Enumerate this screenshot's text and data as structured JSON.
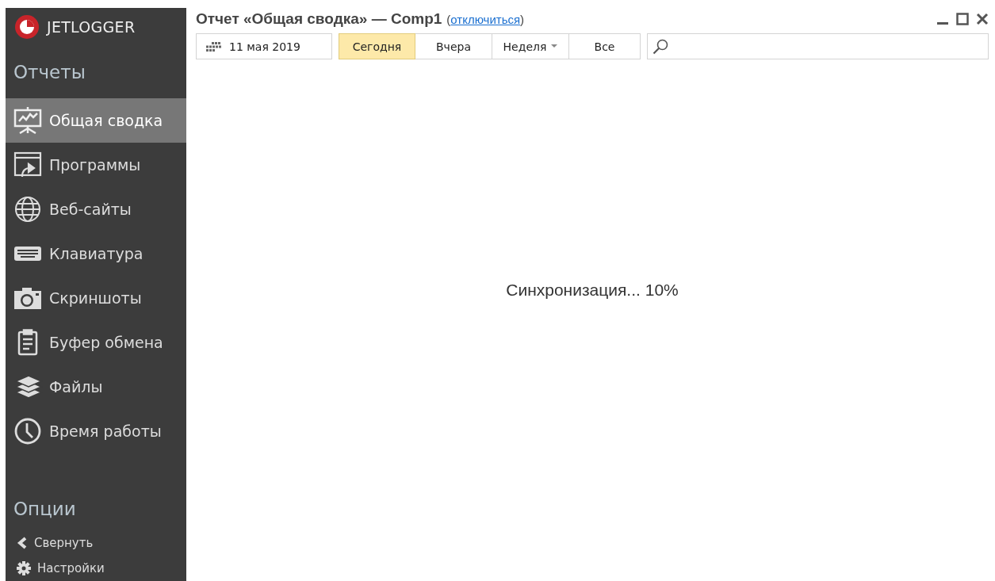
{
  "app": {
    "logo": "JETLOGGER"
  },
  "sidebar": {
    "reports_heading": "Отчеты",
    "items": [
      {
        "label": "Общая сводка",
        "selected": true
      },
      {
        "label": "Программы",
        "selected": false
      },
      {
        "label": "Веб-сайты",
        "selected": false
      },
      {
        "label": "Клавиатура",
        "selected": false
      },
      {
        "label": "Скриншоты",
        "selected": false
      },
      {
        "label": "Буфер обмена",
        "selected": false
      },
      {
        "label": "Файлы",
        "selected": false
      },
      {
        "label": "Время работы",
        "selected": false
      }
    ],
    "options_heading": "Опции",
    "options": [
      {
        "label": "Свернуть"
      },
      {
        "label": "Настройки"
      }
    ]
  },
  "header": {
    "title": "Отчет «Общая сводка» — Comp1",
    "paren_open": "(",
    "link": "отключиться",
    "paren_close": ")"
  },
  "toolbar": {
    "date": "11 мая 2019",
    "periods": [
      {
        "label": "Сегодня",
        "selected": true,
        "dropdown": false
      },
      {
        "label": "Вчера",
        "selected": false,
        "dropdown": false
      },
      {
        "label": "Неделя",
        "selected": false,
        "dropdown": true
      },
      {
        "label": "Все",
        "selected": false,
        "dropdown": false
      }
    ]
  },
  "status": {
    "text": "Синхронизация... 10%"
  }
}
